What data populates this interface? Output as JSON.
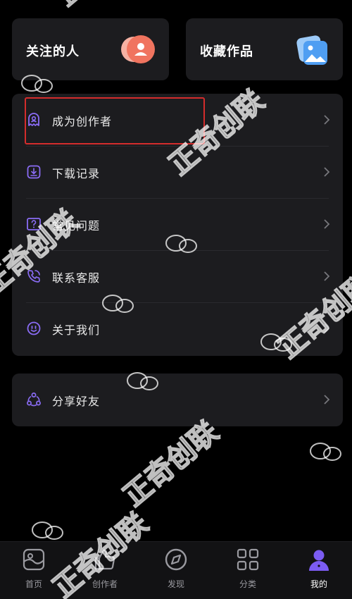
{
  "top_cards": {
    "following_label": "关注的人",
    "favorites_label": "收藏作品"
  },
  "menu": {
    "items": [
      {
        "label": "成为创作者",
        "icon": "ghost-badge-icon"
      },
      {
        "label": "下载记录",
        "icon": "download-icon"
      },
      {
        "label": "常见问题",
        "icon": "question-icon"
      },
      {
        "label": "联系客服",
        "icon": "phone-icon"
      },
      {
        "label": "关于我们",
        "icon": "smile-icon"
      }
    ]
  },
  "share": {
    "label": "分享好友",
    "icon": "share-icon"
  },
  "tabbar": {
    "tabs": [
      {
        "label": "首页",
        "icon": "home-icon"
      },
      {
        "label": "创作者",
        "icon": "thumbs-up-icon"
      },
      {
        "label": "发现",
        "icon": "compass-icon"
      },
      {
        "label": "分类",
        "icon": "grid-icon"
      },
      {
        "label": "我的",
        "icon": "profile-icon",
        "active": true
      }
    ]
  },
  "colors": {
    "background": "#000000",
    "card": "#1c1c1f",
    "accent_purple": "#8a6cf5",
    "highlight_red": "#d42c2c",
    "following_badge": "#f27b6a",
    "favorites_badge": "#5aa8f5"
  },
  "watermark": {
    "text": "正奇创联"
  }
}
